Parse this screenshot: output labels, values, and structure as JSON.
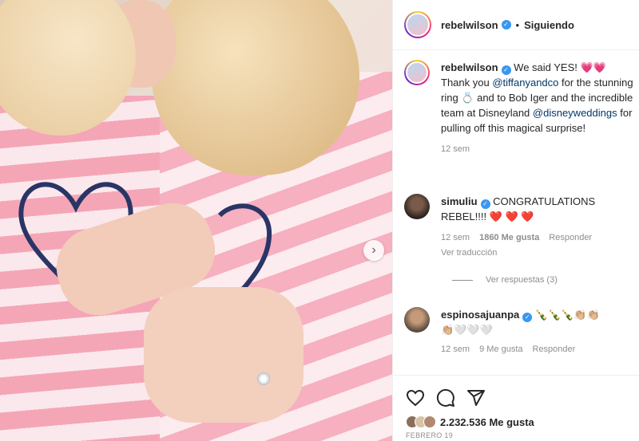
{
  "post": {
    "username": "rebelwilson",
    "follow_status": "Siguiendo",
    "caption": {
      "username": "rebelwilson",
      "part1": "We said YES! ",
      "emoji1": "💗💗",
      "part2": "Thank you ",
      "mention1": "@tiffanyandco",
      "part3": " for the stunning ring ",
      "emoji2": "💍",
      "part4": " and to Bob Iger and the incredible team at Disneyland ",
      "mention2": "@disneyweddings",
      "part5": " for pulling off this magical surprise!",
      "time": "12 sem"
    }
  },
  "comments": [
    {
      "username": "simuliu",
      "text": "CONGRATULATIONS REBEL!!!! ",
      "emoji": "❤️ ❤️ ❤️",
      "time": "12 sem",
      "likes": "1860 Me gusta",
      "reply_label": "Responder",
      "translate_label": "Ver traducción",
      "view_replies": "Ver respuestas (3)"
    },
    {
      "username": "espinosajuanpa",
      "emoji_line1": "🍾🍾🍾👏🏼👏🏼",
      "emoji_line2": "👏🏼🤍🤍🤍",
      "time": "12 sem",
      "likes": "9 Me gusta",
      "reply_label": "Responder"
    }
  ],
  "footer": {
    "like_count": "2.232.536 Me gusta",
    "date": "FEBRERO 19",
    "icons": [
      "heart-icon",
      "comment-icon",
      "share-icon"
    ]
  },
  "colors": {
    "mention": "#00376b",
    "verified": "#3897f0",
    "meta": "#8e8e8e"
  }
}
